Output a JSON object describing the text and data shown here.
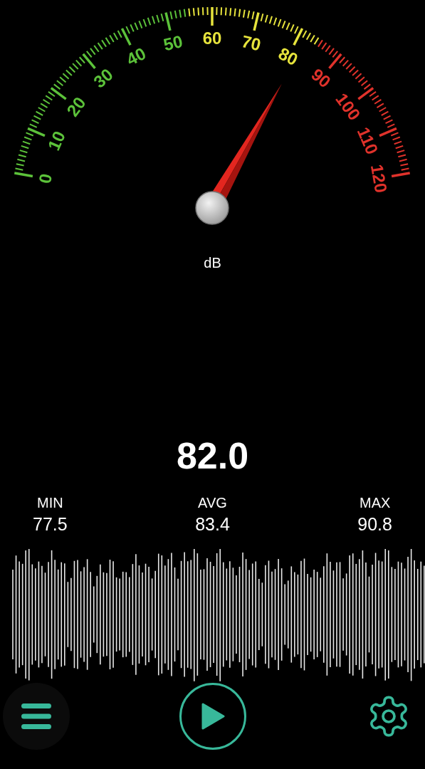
{
  "gauge": {
    "scale_labels": [
      {
        "text": "0",
        "color": "#5cc23a"
      },
      {
        "text": "10",
        "color": "#5cc23a"
      },
      {
        "text": "20",
        "color": "#5cc23a"
      },
      {
        "text": "30",
        "color": "#5cc23a"
      },
      {
        "text": "40",
        "color": "#5cc23a"
      },
      {
        "text": "50",
        "color": "#5cc23a"
      },
      {
        "text": "60",
        "color": "#e6e33c"
      },
      {
        "text": "70",
        "color": "#e6e33c"
      },
      {
        "text": "80",
        "color": "#e6e33c"
      },
      {
        "text": "90",
        "color": "#e0322b"
      },
      {
        "text": "100",
        "color": "#e0322b"
      },
      {
        "text": "110",
        "color": "#e0322b"
      },
      {
        "text": "120",
        "color": "#e0322b"
      }
    ],
    "unit": "dB"
  },
  "reading": "82.0",
  "stats": [
    {
      "label": "MIN",
      "value": "77.5"
    },
    {
      "label": "AVG",
      "value": "83.4"
    },
    {
      "label": "MAX",
      "value": "90.8"
    }
  ]
}
